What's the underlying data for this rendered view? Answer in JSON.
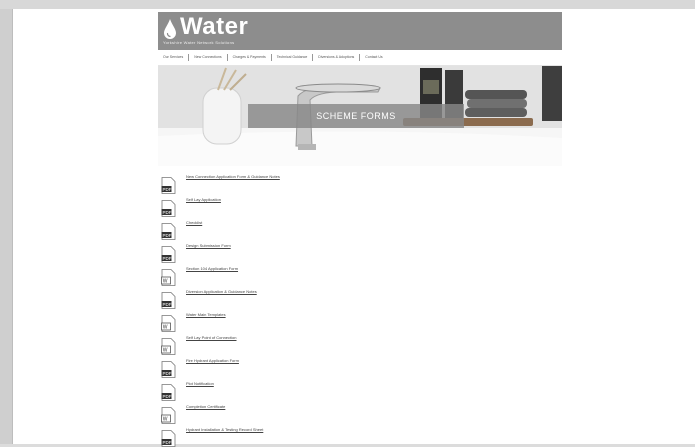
{
  "site": {
    "brand": "Water",
    "tagline": "Yorkshire Water Network Solutions"
  },
  "nav": {
    "items": [
      "Our Services",
      "New Connections",
      "Charges & Payments",
      "Technical Guidance",
      "Diversions & Adoptions",
      "Contact Us"
    ]
  },
  "hero": {
    "banner": "SCHEME FORMS"
  },
  "colors": {
    "header_bg": "#8d8d8d",
    "banner_bg": "#878787"
  },
  "documents": [
    {
      "label": "New Connection Application Form & Guidance Notes",
      "icon": "pdf-file-icon"
    },
    {
      "label": "Self Lay Application",
      "icon": "pdf-file-icon"
    },
    {
      "label": "Checklist",
      "icon": "pdf-file-icon"
    },
    {
      "label": "Design Submission Form",
      "icon": "pdf-file-icon"
    },
    {
      "label": "Section 104 Application Form",
      "icon": "word-file-icon"
    },
    {
      "label": "Diversion Application & Guidance Notes",
      "icon": "pdf-file-icon"
    },
    {
      "label": "Water Main Templates",
      "icon": "word-file-icon"
    },
    {
      "label": "Self Lay Point of Connection",
      "icon": "word-file-icon"
    },
    {
      "label": "Fire Hydrant Application Form",
      "icon": "pdf-file-icon"
    },
    {
      "label": "Plot Notification",
      "icon": "pdf-file-icon"
    },
    {
      "label": "Completion Certificate",
      "icon": "word-file-icon"
    },
    {
      "label": "Hydrant Installation & Testing Record Sheet",
      "icon": "pdf-file-icon"
    }
  ]
}
